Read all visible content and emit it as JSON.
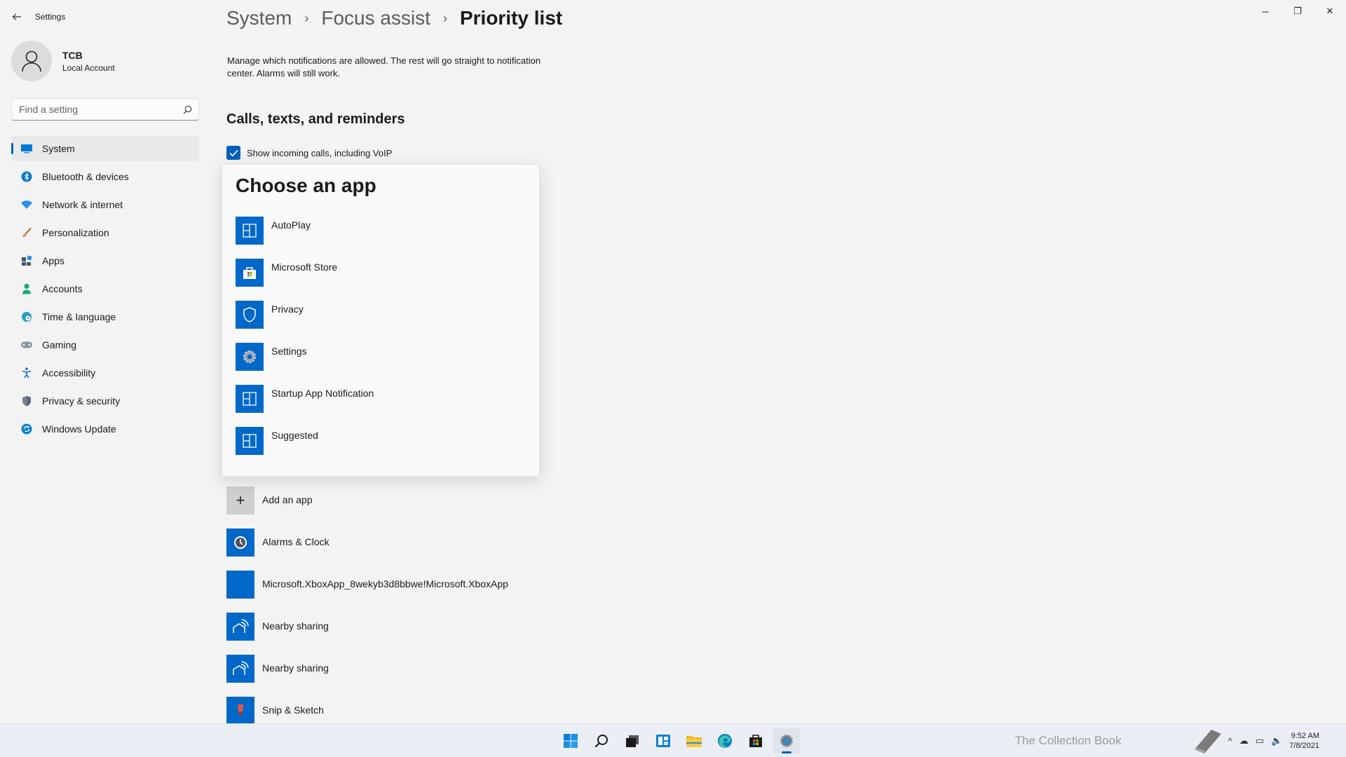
{
  "window": {
    "title": "Settings",
    "controls": {
      "minimize": "─",
      "restore": "❐",
      "close": "✕"
    }
  },
  "profile": {
    "name": "TCB",
    "account_type": "Local Account"
  },
  "search": {
    "placeholder": "Find a setting"
  },
  "sidebar": {
    "items": [
      {
        "label": "System",
        "icon": "system-icon",
        "active": true
      },
      {
        "label": "Bluetooth & devices",
        "icon": "bluetooth-icon"
      },
      {
        "label": "Network & internet",
        "icon": "wifi-icon"
      },
      {
        "label": "Personalization",
        "icon": "brush-icon"
      },
      {
        "label": "Apps",
        "icon": "apps-icon"
      },
      {
        "label": "Accounts",
        "icon": "accounts-icon"
      },
      {
        "label": "Time & language",
        "icon": "globe-clock-icon"
      },
      {
        "label": "Gaming",
        "icon": "gamepad-icon"
      },
      {
        "label": "Accessibility",
        "icon": "accessibility-icon"
      },
      {
        "label": "Privacy & security",
        "icon": "shield-icon"
      },
      {
        "label": "Windows Update",
        "icon": "update-icon"
      }
    ]
  },
  "breadcrumb": {
    "level1": "System",
    "level2": "Focus assist",
    "current": "Priority list",
    "separator": "›"
  },
  "main": {
    "description": "Manage which notifications are allowed. The rest will go straight to notification center. Alarms will still work.",
    "section_title": "Calls, texts, and reminders",
    "checkbox": {
      "label": "Show incoming calls, including VoIP",
      "checked": true
    },
    "app_list": [
      {
        "label": "Add an app",
        "icon": "plus-icon"
      },
      {
        "label": "Alarms & Clock",
        "icon": "clock-icon"
      },
      {
        "label": "Microsoft.XboxApp_8wekyb3d8bbwe!Microsoft.XboxApp",
        "icon": "blank-tile-icon"
      },
      {
        "label": "Nearby sharing",
        "icon": "nearby-sharing-icon"
      },
      {
        "label": "Nearby sharing",
        "icon": "nearby-sharing-icon"
      },
      {
        "label": "Snip & Sketch",
        "icon": "snip-sketch-icon"
      }
    ]
  },
  "popup": {
    "title": "Choose an app",
    "items": [
      {
        "label": "AutoPlay",
        "icon": "app-tile-icon"
      },
      {
        "label": "Microsoft Store",
        "icon": "store-icon"
      },
      {
        "label": "Privacy",
        "icon": "shield-icon"
      },
      {
        "label": "Settings",
        "icon": "gear-icon"
      },
      {
        "label": "Startup App Notification",
        "icon": "app-tile-icon"
      },
      {
        "label": "Suggested",
        "icon": "app-tile-icon"
      }
    ]
  },
  "taskbar": {
    "apps": [
      "start-icon",
      "search-icon",
      "task-view-icon",
      "widgets-icon",
      "file-explorer-icon",
      "edge-icon",
      "store-icon",
      "settings-icon"
    ],
    "watermark": "The Collection Book",
    "time": "9:52 AM",
    "date": "7/8/2021"
  },
  "colors": {
    "accent": "#005fb8",
    "tile": "#0068c9",
    "background": "#f3f3f3"
  }
}
